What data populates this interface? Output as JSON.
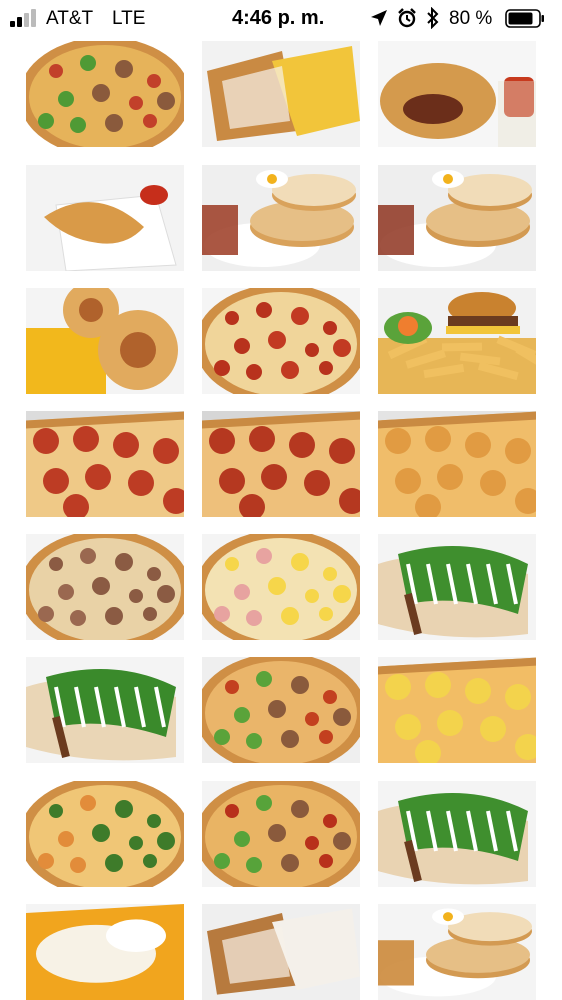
{
  "status_bar": {
    "carrier": "AT&T",
    "network": "LTE",
    "time": "4:46 p. m.",
    "battery_percent": "80 %",
    "icons": [
      "signal-icon",
      "location-arrow-icon",
      "alarm-icon",
      "bluetooth-icon",
      "battery-icon"
    ]
  },
  "gallery": {
    "columns": 3,
    "photos": [
      {
        "subject": "supreme-pizza",
        "kind": "pizza",
        "base": "#e6b35a",
        "toppings": [
          "#c2402a",
          "#4f9a35",
          "#8a5a3c"
        ],
        "bg": "#ffffff"
      },
      {
        "subject": "french-toast-with-eggs",
        "kind": "toast",
        "base": "#c98a43",
        "accent": "#f2c53a",
        "bg": "#f2f2f2"
      },
      {
        "subject": "calzone-with-sauce",
        "kind": "calzone",
        "base": "#d49a4d",
        "accent": "#c73a1e",
        "bg": "#f6f6f6"
      },
      {
        "subject": "empanada-plate",
        "kind": "empanada",
        "base": "#d99a48",
        "accent": "#c62e1b",
        "bg": "#f3f3f3"
      },
      {
        "subject": "pancakes-bacon-eggs",
        "kind": "pancakes",
        "base": "#d9a25b",
        "accent": "#9b3a22",
        "bg": "#efefef"
      },
      {
        "subject": "pancakes-bacon-eggs-2",
        "kind": "pancakes",
        "base": "#d39a52",
        "accent": "#8e3420",
        "bg": "#eeeeee"
      },
      {
        "subject": "pizza-rolls",
        "kind": "rolls",
        "base": "#e1aa5e",
        "accent": "#f2b81c",
        "bg": "#f4f4f4"
      },
      {
        "subject": "pepperoni-pizza-whole",
        "kind": "pizza",
        "base": "#f0d59a",
        "toppings": [
          "#b8321d",
          "#b8321d",
          "#c23a22"
        ],
        "bg": "#f5f5f5"
      },
      {
        "subject": "burger-and-fries",
        "kind": "burger",
        "base": "#e7b656",
        "accent": "#6b3b1f",
        "bg": "#f2f2f2"
      },
      {
        "subject": "pepperoni-slice-1",
        "kind": "slice",
        "base": "#efc987",
        "toppings": [
          "#b8301b"
        ],
        "bg": "#dcdcdc"
      },
      {
        "subject": "pepperoni-slice-2",
        "kind": "slice",
        "base": "#eec07b",
        "toppings": [
          "#b02d18"
        ],
        "bg": "#d6d6d6"
      },
      {
        "subject": "cheese-slice",
        "kind": "slice",
        "base": "#f0bd6a",
        "toppings": [
          "#e0983f"
        ],
        "bg": "#e4e4e4"
      },
      {
        "subject": "sausage-pizza",
        "kind": "pizza",
        "base": "#e9d2a6",
        "toppings": [
          "#8b5b43",
          "#9a6850",
          "#8b5b43"
        ],
        "bg": "#f4f4f4"
      },
      {
        "subject": "hawaiian-pizza",
        "kind": "pizza",
        "base": "#f3e2b3",
        "toppings": [
          "#f6d64a",
          "#e7a3a0",
          "#f6d64a"
        ],
        "bg": "#f4f4f4"
      },
      {
        "subject": "gyro-wrap",
        "kind": "wrap",
        "base": "#e9d3b2",
        "accent": "#3f8f2e",
        "bg": "#f4f4f4"
      },
      {
        "subject": "gyro-wrap-2",
        "kind": "wrap",
        "base": "#ead6b6",
        "accent": "#3a8a2b",
        "bg": "#f4f4f4"
      },
      {
        "subject": "sausage-pepper-pizza-spread",
        "kind": "pizza",
        "base": "#eab56a",
        "toppings": [
          "#c3401f",
          "#5aa33a",
          "#8a5a3c"
        ],
        "bg": "#efefef"
      },
      {
        "subject": "hawaiian-pizza-close",
        "kind": "slice",
        "base": "#f2bd65",
        "toppings": [
          "#f3d54a"
        ],
        "bg": "#f3f3f3"
      },
      {
        "subject": "spinach-pizza",
        "kind": "pizza",
        "base": "#f0c676",
        "toppings": [
          "#3e7b2a",
          "#e28c3a",
          "#3e7b2a"
        ],
        "bg": "#ffffff"
      },
      {
        "subject": "pepper-pepperoni-pizza",
        "kind": "pizza",
        "base": "#e9b464",
        "toppings": [
          "#b8301b",
          "#57a33a",
          "#8a5a3c"
        ],
        "bg": "#f4f4f4"
      },
      {
        "subject": "wrap-with-fries",
        "kind": "wrap",
        "base": "#e9d3b2",
        "accent": "#3f8f2e",
        "bg": "#f4f4f4"
      },
      {
        "subject": "cheese-fries-tray",
        "kind": "tray",
        "base": "#f1a51e",
        "accent": "#f7f2e6",
        "bg": "#f4f4f4"
      },
      {
        "subject": "french-toast",
        "kind": "toast",
        "base": "#b77a3e",
        "accent": "#f4f0ea",
        "bg": "#efefef"
      },
      {
        "subject": "pancakes-stack",
        "kind": "pancakes",
        "base": "#d39a52",
        "accent": "#c9822f",
        "bg": "#f4f4f4"
      }
    ]
  }
}
